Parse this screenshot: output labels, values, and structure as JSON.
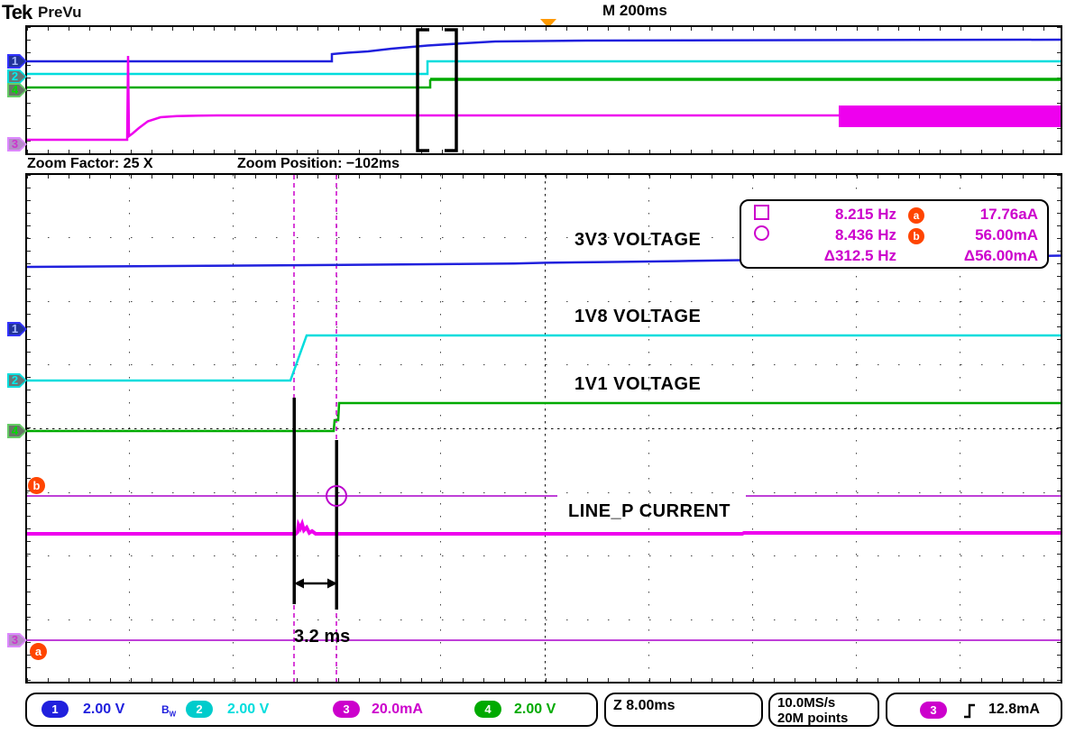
{
  "header": {
    "logo": "Tek",
    "status": "PreVu",
    "timebase": "M 200ms"
  },
  "zoom_bar": {
    "factor_label": "Zoom Factor: 25 X",
    "position_label": "Zoom Position: −102ms"
  },
  "channels": {
    "ch1": {
      "num": "1",
      "color": "#2020dd"
    },
    "ch2": {
      "num": "2",
      "color": "#00dddd"
    },
    "ch3": {
      "num": "3",
      "color": "#ee00ee"
    },
    "ch4": {
      "num": "4",
      "color": "#00aa00"
    },
    "cursor_a": "a",
    "cursor_b": "b"
  },
  "measurement_box": {
    "rows": [
      {
        "symbol": "square",
        "freq": "8.215 Hz",
        "badge": "a",
        "amp": "17.76aA"
      },
      {
        "symbol": "circle",
        "freq": "8.436 Hz",
        "badge": "b",
        "amp": "56.00mA"
      },
      {
        "symbol": "",
        "freq": "Δ312.5 Hz",
        "badge": "",
        "amp": "Δ56.00mA"
      }
    ]
  },
  "trace_labels": {
    "ch1_label": "3V3 VOLTAGE",
    "ch2_label": "1V8 VOLTAGE",
    "ch4_label": "1V1 VOLTAGE",
    "ch3_label": "LINE_P CURRENT"
  },
  "annotation": {
    "delta_time": "3.2 ms"
  },
  "readouts": {
    "ch1_scale": "2.00 V",
    "bw": "B",
    "bw_sub": "W",
    "ch2_scale": "2.00 V",
    "ch3_scale": "20.0mA",
    "ch4_scale": "2.00 V",
    "zoom_scale": "Z 8.00ms",
    "sample_rate": "10.0MS/s",
    "record_length": "20M points",
    "trigger_level": "12.8mA"
  },
  "colors": {
    "ch1": "#2020dd",
    "ch2": "#00dddd",
    "ch3": "#ee00ee",
    "ch4": "#00aa00",
    "cursor": "#bb00cc",
    "badge": "#ff4500",
    "trigger_marker": "#ff9900"
  }
}
